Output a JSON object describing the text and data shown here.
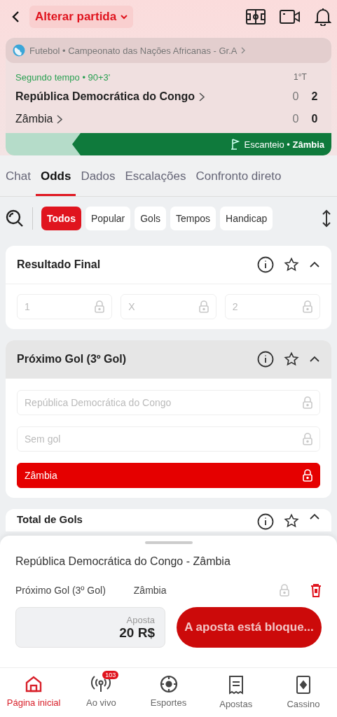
{
  "header": {
    "title": "Alterar partida"
  },
  "league": "Futebol • Campeonato das Nações Africanas - Gr.A",
  "match": {
    "status": "Segundo tempo • 90+3'",
    "period_label": "1°T",
    "teams": [
      {
        "name": "República Democrática do Congo",
        "period_score": "0",
        "score": "2"
      },
      {
        "name": "Zâmbia",
        "period_score": "0",
        "score": "0"
      }
    ]
  },
  "event": {
    "text": "Escanteio • **Zâmbia**"
  },
  "tabs": [
    {
      "label": "Chat",
      "selected": false
    },
    {
      "label": "Odds",
      "selected": true
    },
    {
      "label": "Dados",
      "selected": false
    },
    {
      "label": "Escalações",
      "selected": false
    },
    {
      "label": "Confronto direto",
      "selected": false
    }
  ],
  "filters": [
    {
      "label": "Todos",
      "selected": true
    },
    {
      "label": "Popular",
      "selected": false
    },
    {
      "label": "Gols",
      "selected": false
    },
    {
      "label": "Tempos",
      "selected": false
    },
    {
      "label": "Handicap",
      "selected": false
    }
  ],
  "markets": [
    {
      "title": "Resultado Final",
      "expanded": true,
      "highlighted": false,
      "kind": "row",
      "options": [
        {
          "label": "1",
          "locked": true,
          "selected": false
        },
        {
          "label": "X",
          "locked": true,
          "selected": false
        },
        {
          "label": "2",
          "locked": true,
          "selected": false
        }
      ]
    },
    {
      "title": "Próximo Gol (3º Gol)",
      "expanded": true,
      "highlighted": true,
      "kind": "column",
      "options": [
        {
          "label": "República Democrática do Congo",
          "locked": true,
          "selected": false
        },
        {
          "label": "Sem gol",
          "locked": true,
          "selected": false
        },
        {
          "label": "Zâmbia",
          "locked": true,
          "selected": true
        }
      ]
    },
    {
      "title": "Total de Gols",
      "expanded": true,
      "highlighted": false,
      "kind": "peek"
    }
  ],
  "bet_slip": {
    "match": "República Democrática do Congo - Zâmbia",
    "market": "Próximo Gol (3º Gol)",
    "selection": "Zâmbia",
    "locked": true,
    "stake_label": "Aposta",
    "stake": "20 R$",
    "button": "A aposta está bloque..."
  },
  "nav": [
    {
      "label": "Página inicial",
      "kind": "home",
      "selected": true
    },
    {
      "label": "Ao vivo",
      "kind": "live",
      "selected": false,
      "badge": "103"
    },
    {
      "label": "Esportes",
      "kind": "sports",
      "selected": false
    },
    {
      "label": "Apostas",
      "kind": "bets",
      "selected": false
    },
    {
      "label": "Cassino",
      "kind": "casino",
      "selected": false
    }
  ]
}
